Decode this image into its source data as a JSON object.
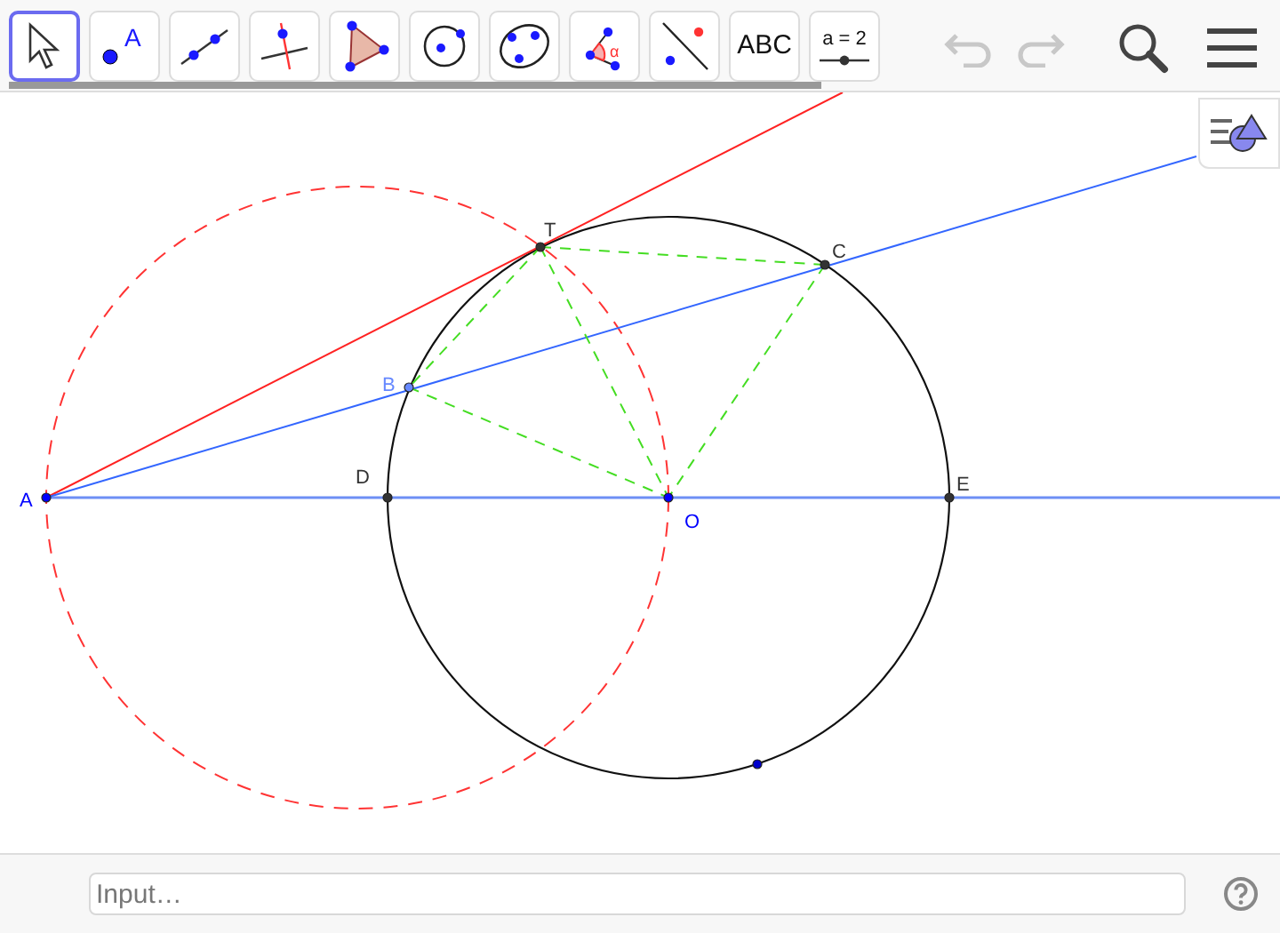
{
  "toolbar": {
    "tools": [
      {
        "kind": "move",
        "selected": true
      },
      {
        "kind": "point",
        "label": "A",
        "selected": false
      },
      {
        "kind": "line",
        "selected": false
      },
      {
        "kind": "perpendicular",
        "selected": false
      },
      {
        "kind": "polygon",
        "selected": false
      },
      {
        "kind": "circle",
        "selected": false
      },
      {
        "kind": "conic",
        "selected": false
      },
      {
        "kind": "angle",
        "label": "α",
        "selected": false
      },
      {
        "kind": "reflect",
        "selected": false
      },
      {
        "kind": "text",
        "label": "ABC",
        "selected": false
      },
      {
        "kind": "slider",
        "label": "a = 2",
        "selected": false
      }
    ],
    "undo": {
      "disabled": true
    },
    "redo": {
      "disabled": true
    }
  },
  "points": [
    {
      "label": "A",
      "color": "#0000ff"
    },
    {
      "label": "O",
      "color": "#0000ff"
    },
    {
      "label": "D",
      "color": "#333333"
    },
    {
      "label": "E",
      "color": "#333333"
    },
    {
      "label": "T",
      "color": "#333333"
    },
    {
      "label": "C",
      "color": "#333333"
    },
    {
      "label": "B",
      "color": "#6688ff"
    }
  ],
  "input_bar": {
    "placeholder": "Input…"
  }
}
